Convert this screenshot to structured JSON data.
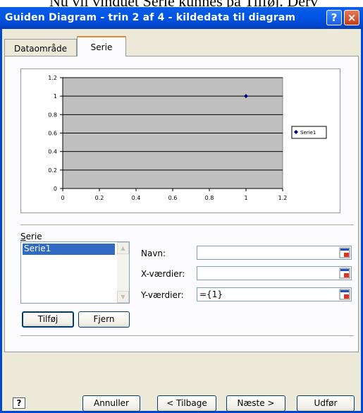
{
  "background_text": "Nu vil vinduet Serie kunnes på Tilføj. Derv",
  "window": {
    "title": "Guiden Diagram - trin 2 af 4 - kildedata til diagram",
    "help": "?",
    "close": "×"
  },
  "tabs": [
    {
      "label": "Dataområde"
    },
    {
      "label": "Serie"
    }
  ],
  "chart_data": {
    "type": "scatter",
    "series": [
      {
        "name": "Serie1",
        "x": [
          1
        ],
        "y": [
          1
        ]
      }
    ],
    "xlim": [
      0,
      1.2
    ],
    "ylim": [
      0,
      1.2
    ],
    "x_ticks": [
      "0",
      "0.2",
      "0.4",
      "0.6",
      "0.8",
      "1",
      "1.2"
    ],
    "y_ticks": [
      "0",
      "0.2",
      "0.4",
      "0.6",
      "0.8",
      "1",
      "1.2"
    ],
    "grid": "horizontal",
    "plot_background": "#c0c0c0",
    "marker_color": "#000080",
    "legend_position": "right"
  },
  "serie_section": {
    "label": "Serie",
    "items": [
      "Serie1"
    ]
  },
  "buttons": {
    "add": "Tilføj",
    "remove": "Fjern"
  },
  "fields": {
    "name": {
      "label": "Navn:",
      "value": ""
    },
    "x_values": {
      "label": "X-værdier:",
      "value": ""
    },
    "y_values": {
      "label": "Y-værdier:",
      "value": "={1}"
    }
  },
  "footer": {
    "help_icon": "?",
    "cancel": "Annuller",
    "back": "< Tilbage",
    "next": "Næste >",
    "finish": "Udfør"
  }
}
